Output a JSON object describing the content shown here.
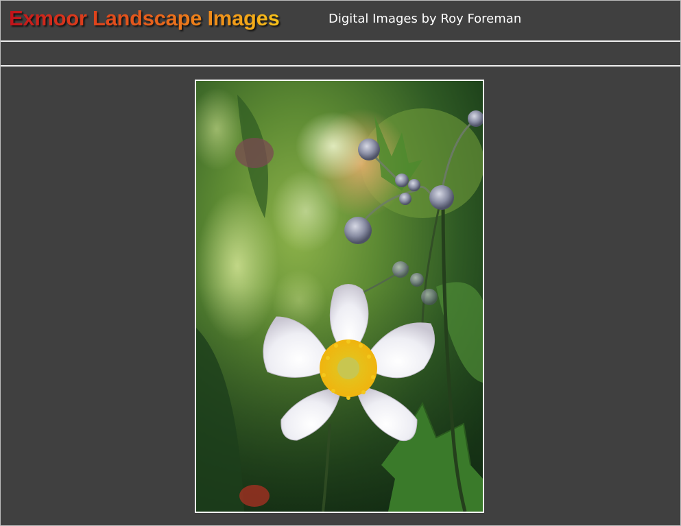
{
  "header": {
    "title": "Exmoor Landscape Images",
    "subtitle": "Digital Images by Roy Foreman"
  },
  "photo": {
    "subject": "white anemone flower",
    "colors": {
      "background": "#404040",
      "border": "#ffffff",
      "title_gradient_start": "#c0121a",
      "title_gradient_end": "#f6c21a"
    }
  }
}
